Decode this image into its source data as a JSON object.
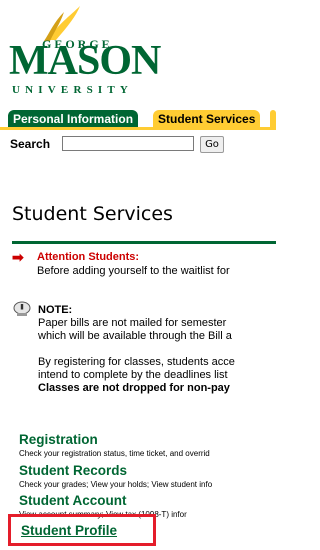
{
  "logo": {
    "line1": "GEORGE",
    "line2": "MASON",
    "line3": "UNIVERSITY"
  },
  "tabs": [
    {
      "label": "Personal Information",
      "active": false
    },
    {
      "label": "Student Services",
      "active": true
    }
  ],
  "search": {
    "label": "Search",
    "value": "",
    "button_label": "Go"
  },
  "page_title": "Student Services",
  "attention": {
    "heading": "Attention Students:",
    "text": "Before adding yourself to the waitlist for"
  },
  "note": {
    "heading": "NOTE:",
    "lines": [
      "Paper bills are not mailed for semester",
      "which will be available through the Bill a"
    ],
    "para2": [
      "By registering for classes, students acce",
      "intend to complete by the deadlines list"
    ],
    "bold_line": "Classes are not dropped for non-pay"
  },
  "menu": [
    {
      "label": "Registration",
      "desc": "Check your registration status, time ticket, and overrid"
    },
    {
      "label": "Student Records",
      "desc": "Check your grades; View your holds; View student info"
    },
    {
      "label": "Student Account",
      "desc": "View account summary; View tax (1098-T) infor"
    },
    {
      "label": "Student Profile",
      "desc": ""
    }
  ],
  "colors": {
    "gmu_green": "#006633",
    "gmu_gold": "#ffcc33",
    "attention_red": "#cc0000",
    "highlight_red": "#e41d2a"
  }
}
